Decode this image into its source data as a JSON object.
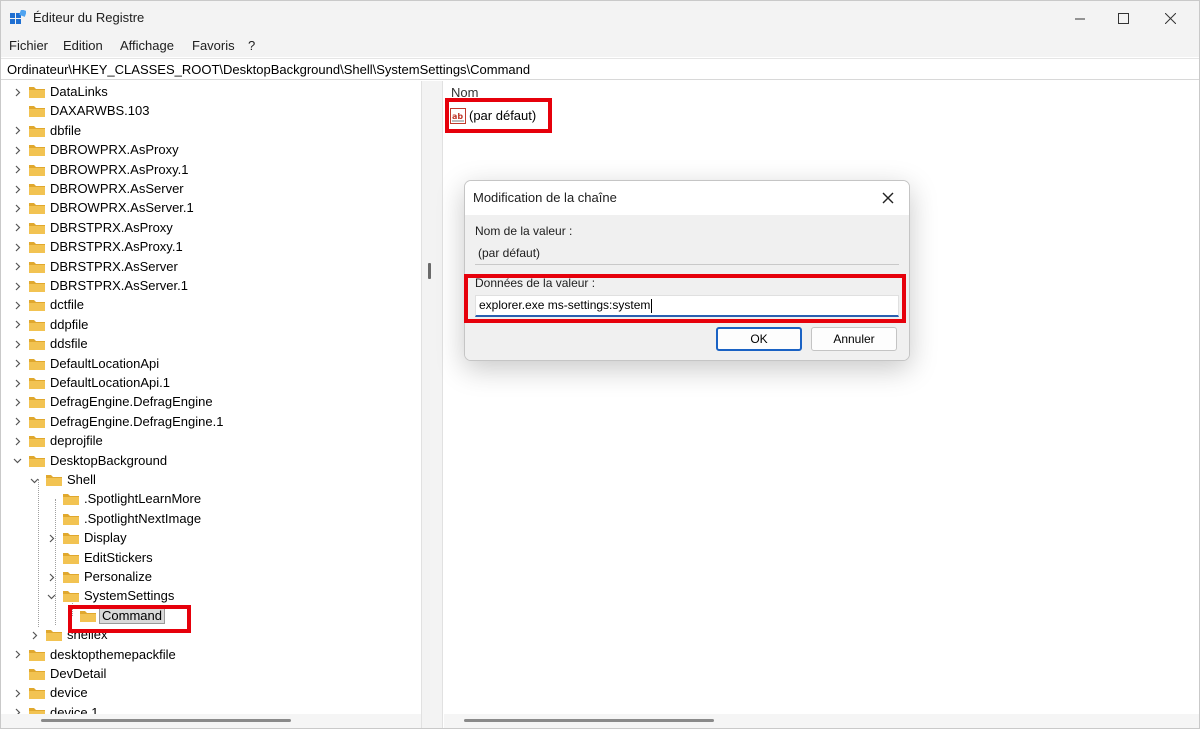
{
  "window": {
    "title": "Éditeur du Registre"
  },
  "menu": [
    "Fichier",
    "Edition",
    "Affichage",
    "Favoris",
    "?"
  ],
  "address": "Ordinateur\\HKEY_CLASSES_ROOT\\DesktopBackground\\Shell\\SystemSettings\\Command",
  "tree": {
    "items": [
      {
        "label": "DataLinks",
        "level": 0,
        "expander": "collapsed"
      },
      {
        "label": "DAXARWBS.103",
        "level": 0,
        "expander": "none"
      },
      {
        "label": "dbfile",
        "level": 0,
        "expander": "collapsed"
      },
      {
        "label": "DBROWPRX.AsProxy",
        "level": 0,
        "expander": "collapsed"
      },
      {
        "label": "DBROWPRX.AsProxy.1",
        "level": 0,
        "expander": "collapsed"
      },
      {
        "label": "DBROWPRX.AsServer",
        "level": 0,
        "expander": "collapsed"
      },
      {
        "label": "DBROWPRX.AsServer.1",
        "level": 0,
        "expander": "collapsed"
      },
      {
        "label": "DBRSTPRX.AsProxy",
        "level": 0,
        "expander": "collapsed"
      },
      {
        "label": "DBRSTPRX.AsProxy.1",
        "level": 0,
        "expander": "collapsed"
      },
      {
        "label": "DBRSTPRX.AsServer",
        "level": 0,
        "expander": "collapsed"
      },
      {
        "label": "DBRSTPRX.AsServer.1",
        "level": 0,
        "expander": "collapsed"
      },
      {
        "label": "dctfile",
        "level": 0,
        "expander": "collapsed"
      },
      {
        "label": "ddpfile",
        "level": 0,
        "expander": "collapsed"
      },
      {
        "label": "ddsfile",
        "level": 0,
        "expander": "collapsed"
      },
      {
        "label": "DefaultLocationApi",
        "level": 0,
        "expander": "collapsed"
      },
      {
        "label": "DefaultLocationApi.1",
        "level": 0,
        "expander": "collapsed"
      },
      {
        "label": "DefragEngine.DefragEngine",
        "level": 0,
        "expander": "collapsed"
      },
      {
        "label": "DefragEngine.DefragEngine.1",
        "level": 0,
        "expander": "collapsed"
      },
      {
        "label": "deprojfile",
        "level": 0,
        "expander": "collapsed"
      },
      {
        "label": "DesktopBackground",
        "level": 0,
        "expander": "expanded"
      },
      {
        "label": "Shell",
        "level": 1,
        "expander": "expanded"
      },
      {
        "label": ".SpotlightLearnMore",
        "level": 2,
        "expander": "none"
      },
      {
        "label": ".SpotlightNextImage",
        "level": 2,
        "expander": "none"
      },
      {
        "label": "Display",
        "level": 2,
        "expander": "collapsed"
      },
      {
        "label": "EditStickers",
        "level": 2,
        "expander": "none"
      },
      {
        "label": "Personalize",
        "level": 2,
        "expander": "collapsed"
      },
      {
        "label": "SystemSettings",
        "level": 2,
        "expander": "expanded"
      },
      {
        "label": "Command",
        "level": 3,
        "expander": "none",
        "selected": true
      },
      {
        "label": "shellex",
        "level": 1,
        "expander": "collapsed"
      },
      {
        "label": "desktopthemepackfile",
        "level": 0,
        "expander": "collapsed"
      },
      {
        "label": "DevDetail",
        "level": 0,
        "expander": "none"
      },
      {
        "label": "device",
        "level": 0,
        "expander": "collapsed"
      },
      {
        "label": "device.1",
        "level": 0,
        "expander": "collapsed"
      }
    ]
  },
  "values": {
    "column_name": "Nom",
    "rows": [
      {
        "name": "(par défaut)",
        "icon": "string-value-icon"
      }
    ]
  },
  "dialog": {
    "title": "Modification de la chaîne",
    "value_name_label": "Nom de la valeur :",
    "value_name": "(par défaut)",
    "value_data_label": "Données de la valeur :",
    "value_data": "explorer.exe ms-settings:system",
    "ok_label": "OK",
    "cancel_label": "Annuler"
  },
  "colors": {
    "highlight": "#e6000b",
    "folder": "#f2c352",
    "focus": "#1a62c4"
  }
}
